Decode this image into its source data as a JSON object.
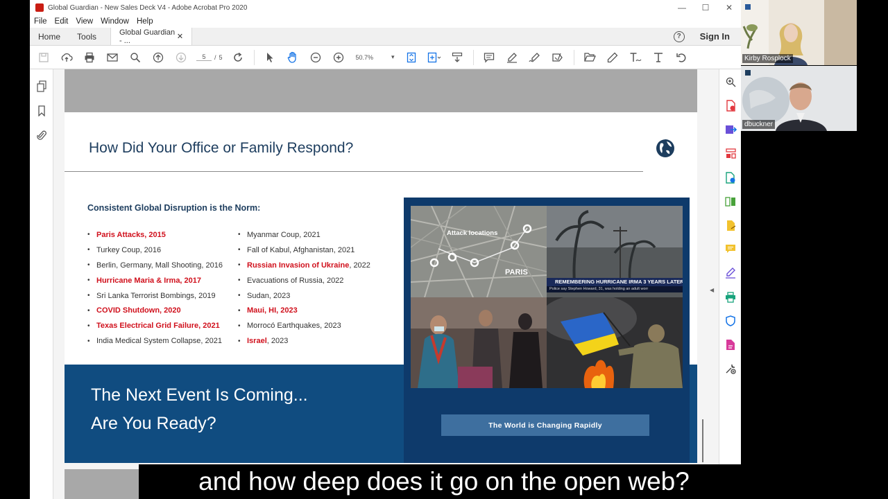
{
  "window": {
    "title": "Global Guardian - New Sales Deck V4 - Adobe Acrobat Pro 2020",
    "controls": [
      "—",
      "☐",
      "✕"
    ]
  },
  "menu": [
    "File",
    "Edit",
    "View",
    "Window",
    "Help"
  ],
  "tabs": {
    "home": "Home",
    "tools": "Tools",
    "document": "Global Guardian - ...",
    "close": "✕",
    "help": "?",
    "sign_in": "Sign In"
  },
  "toolbar": {
    "page_current": "5",
    "page_sep": "/",
    "page_total": "5",
    "zoom": "50.7%",
    "zoom_arrow": "▾"
  },
  "slide": {
    "title": "How Did Your Office or Family Respond?",
    "subhead": "Consistent Global Disruption is the Norm:",
    "col1": [
      {
        "label": "Paris Attacks, 2015",
        "tail": "",
        "red": true
      },
      {
        "label": "Turkey Coup, 2016",
        "tail": "",
        "red": false
      },
      {
        "label": "Berlin, Germany, Mall Shooting, 2016",
        "tail": "",
        "red": false
      },
      {
        "label": "Hurricane Maria & Irma, 2017",
        "tail": "",
        "red": true
      },
      {
        "label": "Sri Lanka Terrorist Bombings, 2019",
        "tail": "",
        "red": false
      },
      {
        "label": "COVID Shutdown, 2020",
        "tail": "",
        "red": true
      },
      {
        "label": "Texas Electrical Grid Failure, 2021",
        "tail": "",
        "red": true
      },
      {
        "label": "India Medical System Collapse, 2021",
        "tail": "",
        "red": false
      }
    ],
    "col2": [
      {
        "label": "Myanmar Coup, 2021",
        "tail": "",
        "red": false
      },
      {
        "label": "Fall of Kabul, Afghanistan, 2021",
        "tail": "",
        "red": false
      },
      {
        "label": "Russian Invasion of Ukraine",
        "tail": ", 2022",
        "red": true
      },
      {
        "label": "Evacuations of Russia, 2022",
        "tail": "",
        "red": false
      },
      {
        "label": "Sudan, 2023",
        "tail": "",
        "red": false
      },
      {
        "label": "Maui, HI, 2023",
        "tail": "",
        "red": true
      },
      {
        "label": "Morrocó Earthquakes, 2023",
        "tail": "",
        "red": false
      },
      {
        "label": "Israel",
        "tail": ", 2023",
        "red": true
      }
    ],
    "photo_labels": {
      "attack_locations": "Attack locations",
      "paris": "PARIS",
      "irma_banner": "REMEMBERING HURRICANE IRMA 3 YEARS LATER",
      "irma_ticker": "Police say Stephen Howard, 31, was holding an adult worr"
    },
    "banner_line1": "The Next Event Is Coming...",
    "banner_line2": "Are You Ready?",
    "button": "The World is Changing Rapidly"
  },
  "participants": [
    {
      "name": "Kirby Rosplock"
    },
    {
      "name": "dbuckner"
    }
  ],
  "caption": "and how deep does it go on the open web?",
  "colors": {
    "accent_red": "#d0101c",
    "navy": "#1d3d5e",
    "banner_blue": "#104c80",
    "acrobat_blue": "#1473e6"
  }
}
